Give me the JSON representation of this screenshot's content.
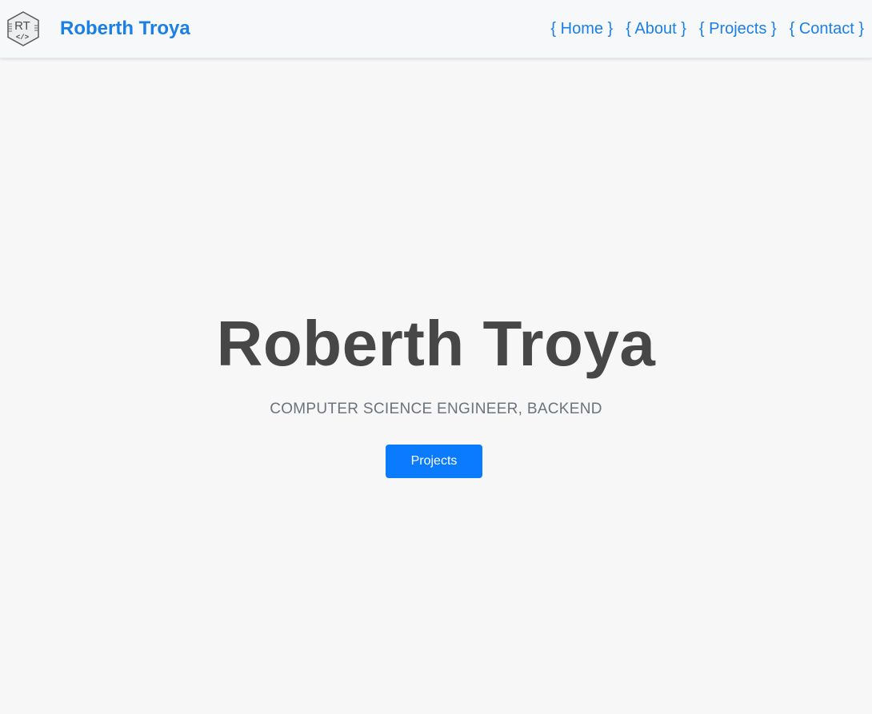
{
  "header": {
    "logo_text": "RT",
    "logo_code": "</>",
    "brand": "Roberth Troya",
    "nav": [
      {
        "label": "{ Home }"
      },
      {
        "label": "{ About }"
      },
      {
        "label": "{ Projects }"
      },
      {
        "label": "{ Contact }"
      }
    ]
  },
  "hero": {
    "title": "Roberth Troya",
    "subtitle": "COMPUTER SCIENCE ENGINEER, BACKEND",
    "button_label": "Projects"
  },
  "colors": {
    "accent": "#1a7fe6",
    "button": "#0a7bff",
    "title": "#474747",
    "subtitle": "#6c737b",
    "background": "#f7f7f7"
  }
}
